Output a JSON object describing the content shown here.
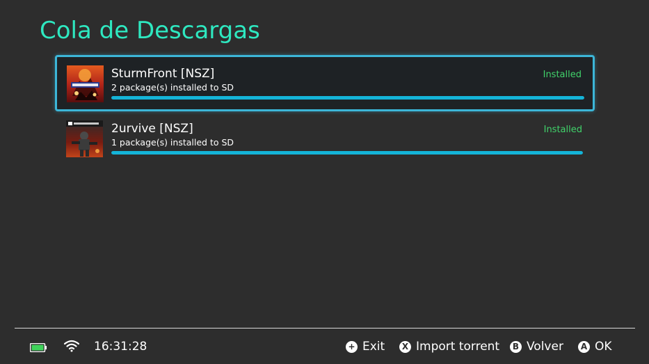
{
  "header": {
    "title": "Cola de Descargas"
  },
  "queue": [
    {
      "title": "SturmFront [NSZ]",
      "subtitle": "2 package(s) installed to SD",
      "status": "Installed",
      "progress": 1.0,
      "selected": true,
      "thumbnail_icon": "sturmfront-cover-art"
    },
    {
      "title": "2urvive [NSZ]",
      "subtitle": "1 package(s) installed to SD",
      "status": "Installed",
      "progress": 1.0,
      "selected": false,
      "thumbnail_icon": "2urvive-cover-art"
    }
  ],
  "status_bar": {
    "battery_icon": "battery-full-icon",
    "wifi_icon": "wifi-icon",
    "time": "16:31:28"
  },
  "footer_hints": [
    {
      "button": "+",
      "label": "Exit"
    },
    {
      "button": "X",
      "label": "Import torrent"
    },
    {
      "button": "B",
      "label": "Volver"
    },
    {
      "button": "A",
      "label": "OK"
    }
  ],
  "colors": {
    "background": "#2d2d2d",
    "title": "#2ee8c0",
    "selection_border": "#3cb6d8",
    "progress": "#14b4d8",
    "status_installed": "#41d36b"
  }
}
